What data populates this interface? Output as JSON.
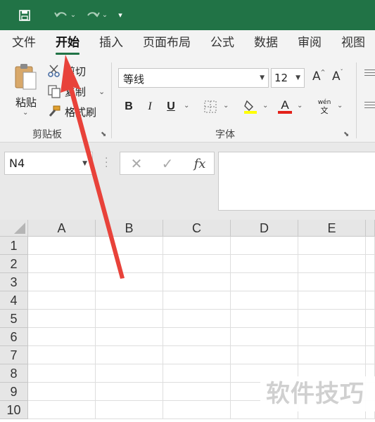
{
  "quick_access": {
    "save": "save-icon",
    "undo": "undo-icon",
    "redo": "redo-icon",
    "customize": "customize-icon"
  },
  "tabs": [
    {
      "label": "文件",
      "active": false
    },
    {
      "label": "开始",
      "active": true
    },
    {
      "label": "插入",
      "active": false
    },
    {
      "label": "页面布局",
      "active": false
    },
    {
      "label": "公式",
      "active": false
    },
    {
      "label": "数据",
      "active": false
    },
    {
      "label": "审阅",
      "active": false
    },
    {
      "label": "视图",
      "active": false
    }
  ],
  "clipboard": {
    "paste_label": "粘贴",
    "cut_label": "剪切",
    "copy_label": "复制",
    "format_painter_label": "格式刷",
    "group_label": "剪贴板"
  },
  "font": {
    "font_name": "等线",
    "font_size": "12",
    "grow_label": "A",
    "shrink_label": "A",
    "bold": "B",
    "italic": "I",
    "underline": "U",
    "font_color_label": "A",
    "phonetic_top": "wén",
    "phonetic_bottom": "文",
    "group_label": "字体",
    "highlight_color": "#ffff00",
    "font_color": "#e32119"
  },
  "formula_bar": {
    "name_box": "N4",
    "cancel": "✕",
    "enter": "✓",
    "fx": "fx",
    "formula": ""
  },
  "grid": {
    "columns": [
      "A",
      "B",
      "C",
      "D",
      "E"
    ],
    "rows": [
      "1",
      "2",
      "3",
      "4",
      "5",
      "6",
      "7",
      "8",
      "9",
      "10"
    ]
  },
  "watermark": "软件技巧",
  "colors": {
    "accent": "#217346",
    "arrow": "#e8423a"
  }
}
